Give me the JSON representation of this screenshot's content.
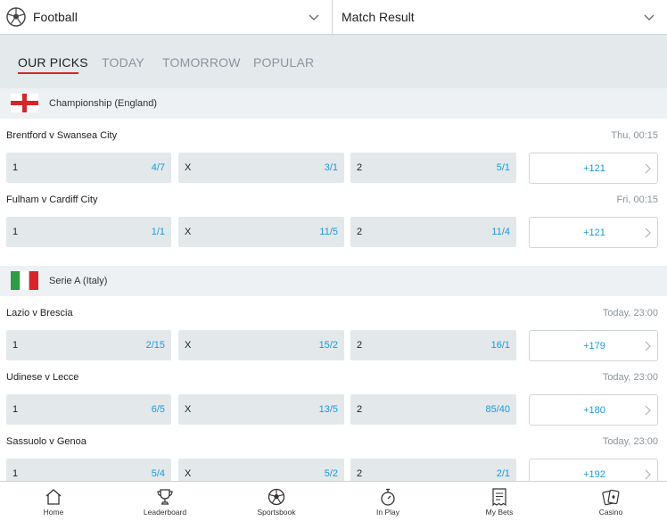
{
  "topbar": {
    "sport_selector": "Football",
    "market_selector": "Match Result"
  },
  "tabs": [
    {
      "label": "OUR PICKS",
      "active": true
    },
    {
      "label": "TODAY",
      "active": false
    },
    {
      "label": "TOMORROW",
      "active": false
    },
    {
      "label": "POPULAR",
      "active": false
    }
  ],
  "leagues": [
    {
      "name": "Championship (England)",
      "flag": "england-flag-icon"
    },
    {
      "name": "Serie A (Italy)",
      "flag": "italy-flag-icon"
    }
  ],
  "matches": [
    {
      "title": "Brentford  v  Swansea City",
      "time": "Thu, 00:15",
      "odds": [
        {
          "sel": "1",
          "price": "4/7"
        },
        {
          "sel": "X",
          "price": "3/1"
        },
        {
          "sel": "2",
          "price": "5/1"
        }
      ],
      "more": "+121"
    },
    {
      "title": "Fulham  v  Cardiff City",
      "time": "Fri, 00:15",
      "odds": [
        {
          "sel": "1",
          "price": "1/1"
        },
        {
          "sel": "X",
          "price": "11/5"
        },
        {
          "sel": "2",
          "price": "11/4"
        }
      ],
      "more": "+121"
    },
    {
      "title": "Lazio  v  Brescia",
      "time": "Today, 23:00",
      "odds": [
        {
          "sel": "1",
          "price": "2/15"
        },
        {
          "sel": "X",
          "price": "15/2"
        },
        {
          "sel": "2",
          "price": "16/1"
        }
      ],
      "more": "+179"
    },
    {
      "title": "Udinese  v  Lecce",
      "time": "Today, 23:00",
      "odds": [
        {
          "sel": "1",
          "price": "6/5"
        },
        {
          "sel": "X",
          "price": "13/5"
        },
        {
          "sel": "2",
          "price": "85/40"
        }
      ],
      "more": "+180"
    },
    {
      "title": "Sassuolo  v  Genoa",
      "time": "Today, 23:00",
      "odds": [
        {
          "sel": "1",
          "price": "5/4"
        },
        {
          "sel": "X",
          "price": "5/2"
        },
        {
          "sel": "2",
          "price": "2/1"
        }
      ],
      "more": "+192"
    }
  ],
  "bottom_nav": [
    {
      "label": "Home",
      "icon": "home-icon"
    },
    {
      "label": "Leaderboard",
      "icon": "trophy-icon"
    },
    {
      "label": "Sportsbook",
      "icon": "football-icon"
    },
    {
      "label": "In Play",
      "icon": "stopwatch-icon"
    },
    {
      "label": "My Bets",
      "icon": "betslip-icon"
    },
    {
      "label": "Casino",
      "icon": "cards-icon"
    }
  ],
  "colors": {
    "accent_red": "#d7262b",
    "price_blue": "#1a9ad6",
    "odds_bg": "#e3e8eb",
    "tabs_bg": "#e4e9ec"
  }
}
